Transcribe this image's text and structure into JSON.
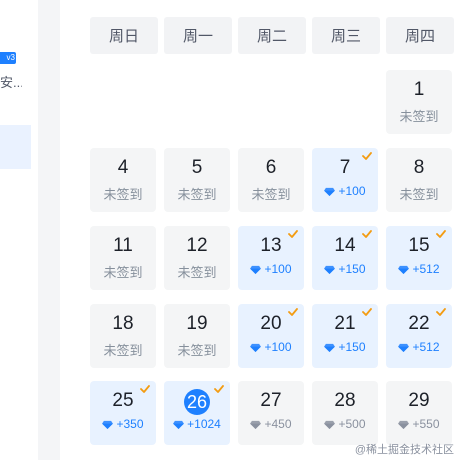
{
  "sidebar": {
    "badge": "v3",
    "text": "安..."
  },
  "calendar": {
    "weekdays": [
      "周日",
      "周一",
      "周二",
      "周三",
      "周四"
    ],
    "accent_color": "#1e80ff",
    "check_color": "#f39c12",
    "days": [
      {
        "day": "1",
        "status": "unsigned",
        "label": "未签到"
      },
      {
        "day": "4",
        "status": "unsigned",
        "label": "未签到"
      },
      {
        "day": "5",
        "status": "unsigned",
        "label": "未签到"
      },
      {
        "day": "6",
        "status": "unsigned",
        "label": "未签到"
      },
      {
        "day": "7",
        "status": "signed",
        "label": "+100"
      },
      {
        "day": "8",
        "status": "unsigned",
        "label": "未签到"
      },
      {
        "day": "11",
        "status": "unsigned",
        "label": "未签到"
      },
      {
        "day": "12",
        "status": "unsigned",
        "label": "未签到"
      },
      {
        "day": "13",
        "status": "signed",
        "label": "+100"
      },
      {
        "day": "14",
        "status": "signed",
        "label": "+150"
      },
      {
        "day": "15",
        "status": "signed",
        "label": "+512"
      },
      {
        "day": "18",
        "status": "unsigned",
        "label": "未签到"
      },
      {
        "day": "19",
        "status": "unsigned",
        "label": "未签到"
      },
      {
        "day": "20",
        "status": "signed",
        "label": "+100"
      },
      {
        "day": "21",
        "status": "signed",
        "label": "+150"
      },
      {
        "day": "22",
        "status": "signed",
        "label": "+512"
      },
      {
        "day": "25",
        "status": "signed",
        "label": "+350"
      },
      {
        "day": "26",
        "status": "today",
        "label": "+1024"
      },
      {
        "day": "27",
        "status": "future",
        "label": "+450"
      },
      {
        "day": "28",
        "status": "future",
        "label": "+500"
      },
      {
        "day": "29",
        "status": "future",
        "label": "+550"
      }
    ]
  },
  "watermark": "@稀土掘金技术社区"
}
